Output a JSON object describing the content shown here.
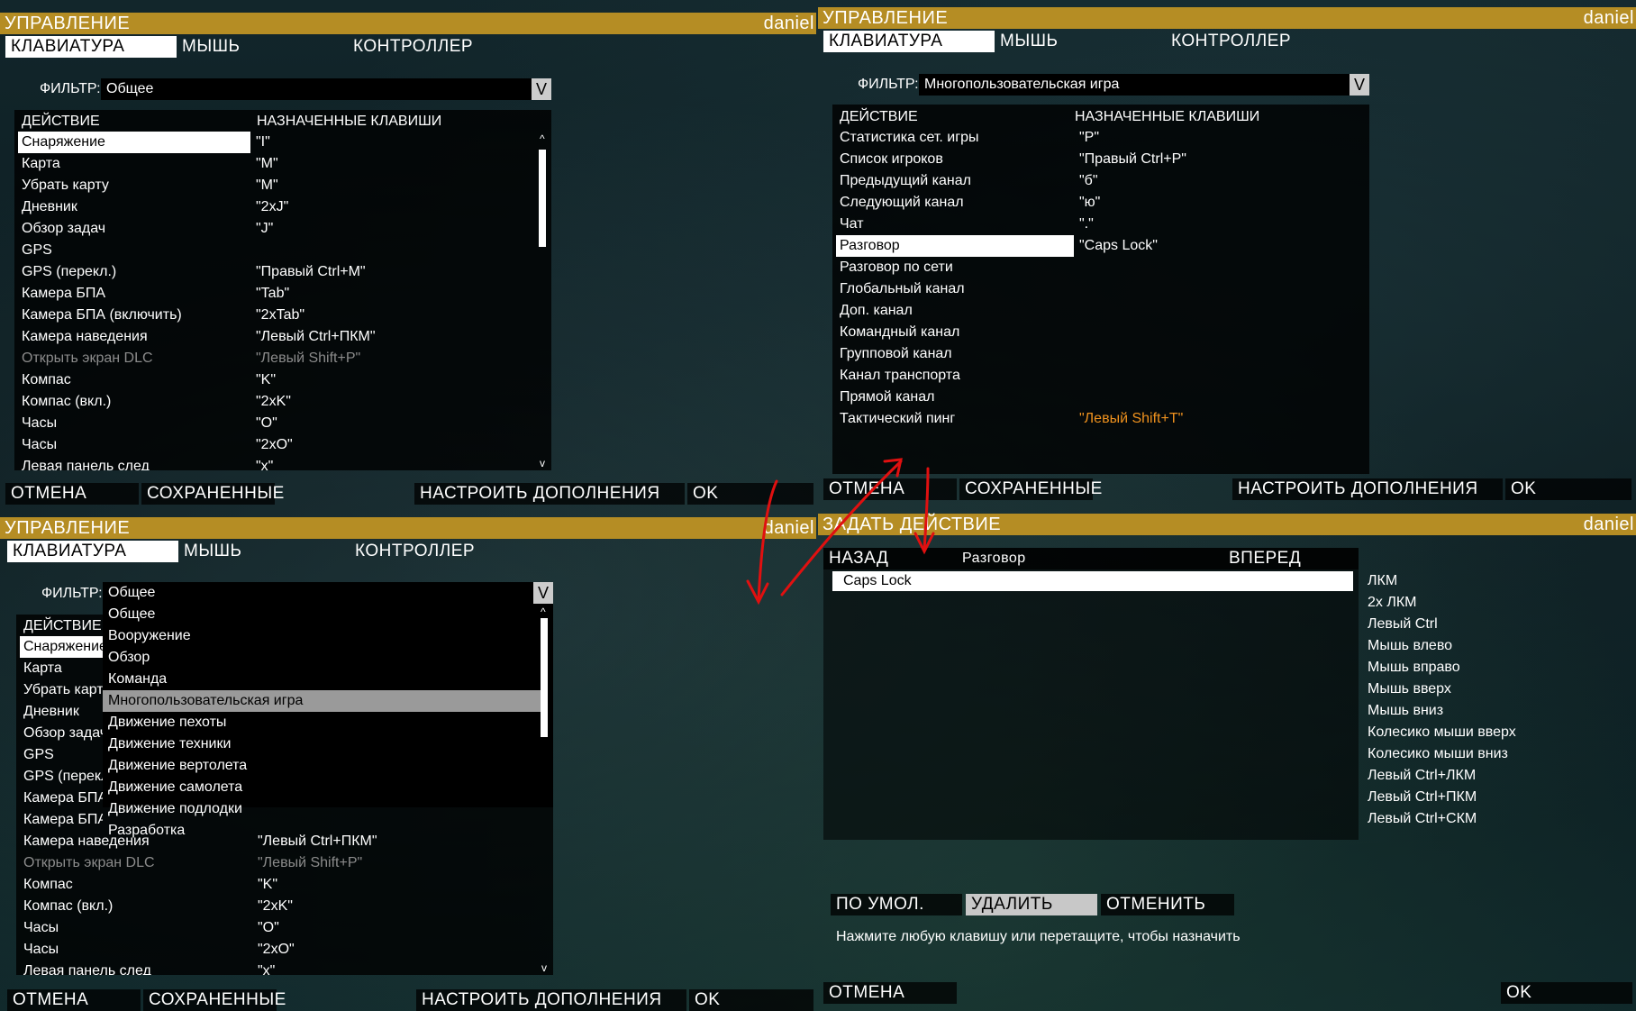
{
  "user": "daniel",
  "controls_title": "УПРАВЛЕНИЕ",
  "tabs": [
    "КЛАВИАТУРА",
    "МЫШЬ",
    "КОНТРОЛЛЕР"
  ],
  "filter_label": "ФИЛЬТР:",
  "dropdown_icon": "V",
  "col_action": "ДЕЙСТВИЕ",
  "col_keys": "НАЗНАЧЕННЫЕ КЛАВИШИ",
  "scroll_up": "^",
  "scroll_down": "v",
  "footer": {
    "cancel": "ОТМЕНА",
    "saved": "СОХРАНЕННЫЕ",
    "addons": "НАСТРОИТЬ ДОПОЛНЕНИЯ",
    "ok": "OK"
  },
  "panel1": {
    "filter_value": "Общее",
    "rows": [
      {
        "action": "Снаряжение",
        "keys": "\"I\""
      },
      {
        "action": "Карта",
        "keys": "\"M\""
      },
      {
        "action": "Убрать карту",
        "keys": "\"M\""
      },
      {
        "action": "Дневник",
        "keys": "\"2xJ\""
      },
      {
        "action": "Обзор задач",
        "keys": "\"J\""
      },
      {
        "action": "GPS",
        "keys": ""
      },
      {
        "action": "GPS (перекл.)",
        "keys": "\"Правый Ctrl+M\""
      },
      {
        "action": "Камера БПА",
        "keys": "\"Tab\""
      },
      {
        "action": "Камера БПА (включить)",
        "keys": "\"2xTab\""
      },
      {
        "action": "Камера наведения",
        "keys": "\"Левый Ctrl+ПКМ\""
      },
      {
        "action": "Открыть экран DLC",
        "keys": "\"Левый Shift+P\""
      },
      {
        "action": "Компас",
        "keys": "\"K\""
      },
      {
        "action": "Компас (вкл.)",
        "keys": "\"2xK\""
      },
      {
        "action": "Часы",
        "keys": "\"O\""
      },
      {
        "action": "Часы",
        "keys": "\"2xO\""
      },
      {
        "action": "Левая панель след",
        "keys": "\"x\""
      }
    ]
  },
  "panel2": {
    "filter_value": "Многопользовательская игра",
    "rows": [
      {
        "action": "Статистика сет. игры",
        "keys": "\"P\""
      },
      {
        "action": "Список игроков",
        "keys": "\"Правый Ctrl+P\""
      },
      {
        "action": "Предыдущий канал",
        "keys": "\"б\""
      },
      {
        "action": "Следующий канал",
        "keys": "\"ю\""
      },
      {
        "action": "Чат",
        "keys": "\".\""
      },
      {
        "action": "Разговор",
        "keys": "\"Caps Lock\""
      },
      {
        "action": "Разговор по сети",
        "keys": ""
      },
      {
        "action": "Глобальный канал",
        "keys": ""
      },
      {
        "action": "Доп. канал",
        "keys": ""
      },
      {
        "action": "Командный канал",
        "keys": ""
      },
      {
        "action": "Групповой канал",
        "keys": ""
      },
      {
        "action": "Канал транспорта",
        "keys": ""
      },
      {
        "action": "Прямой канал",
        "keys": ""
      },
      {
        "action": "Тактический пинг",
        "keys": "\"Левый Shift+T\""
      }
    ]
  },
  "panel3": {
    "filter_value": "Общее",
    "options": [
      "Общее",
      "Вооружение",
      "Обзор",
      "Команда",
      "Многопользовательская игра",
      "Движение пехоты",
      "Движение техники",
      "Движение вертолета",
      "Движение самолета",
      "Движение подлодки",
      "Разработка"
    ],
    "rows_left": [
      "Снаряжение",
      "Карта",
      "Убрать карту",
      "Дневник",
      "Обзор задач",
      "GPS",
      "GPS (перекл.",
      "Камера БПА",
      "Камера БПА"
    ],
    "rows_below": [
      {
        "action": "Камера наведения",
        "keys": "\"Левый Ctrl+ПКМ\""
      },
      {
        "action": "Открыть экран DLC",
        "keys": "\"Левый Shift+P\""
      },
      {
        "action": "Компас",
        "keys": "\"K\""
      },
      {
        "action": "Компас (вкл.)",
        "keys": "\"2xK\""
      },
      {
        "action": "Часы",
        "keys": "\"O\""
      },
      {
        "action": "Часы",
        "keys": "\"2xO\""
      },
      {
        "action": "Левая панель след",
        "keys": "\"x\""
      }
    ]
  },
  "panel4": {
    "title": "ЗАДАТЬ ДЕЙСТВИЕ",
    "back": "НАЗАД",
    "action_name": "Разговор",
    "forward": "ВПЕРЕД",
    "current_key": "Caps Lock",
    "keys": [
      "ЛКМ",
      "2x ЛКМ",
      "Левый Ctrl",
      "Мышь влево",
      "Мышь вправо",
      "Мышь вверх",
      "Мышь вниз",
      "Колесико мыши вверх",
      "Колесико мыши вниз",
      "Левый Ctrl+ЛКМ",
      "Левый Ctrl+ПКМ",
      "Левый Ctrl+СКМ"
    ],
    "default": "ПО УМОЛ.",
    "delete": "УДАЛИТЬ",
    "undo": "ОТМЕНИТЬ",
    "hint": "Нажмите любую клавишу или перетащите, чтобы назначить",
    "cancel": "ОТМЕНА",
    "ok": "OK"
  },
  "arrow_color": "#e01010"
}
